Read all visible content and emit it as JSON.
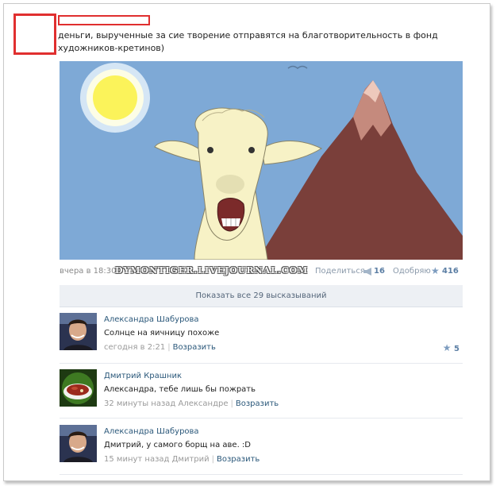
{
  "post": {
    "text": "деньги, вырученные за сие творение отправятся на благотворительность в фонд художников-кретинов)",
    "date": "вчера в 18:30",
    "watermark": "DYMONTIGER.LIVEJOURNAL.COM",
    "share_label": "Поделиться",
    "share_count": "16",
    "like_label": "Одобряю",
    "like_count": "416"
  },
  "comments_header": {
    "show_all_label": "Показать все 29 высказываний"
  },
  "comments": [
    {
      "author": "Александра Шабурова",
      "text": "Солнце на яичницу похоже",
      "time": "сегодня в 2:21",
      "reply_label": "Возразить",
      "likes": "5"
    },
    {
      "author": "Дмитрий Крашник",
      "text": "Александра, тебе лишь бы пожрать",
      "time": "32 минуты назад Александре",
      "reply_label": "Возразить"
    },
    {
      "author": "Александра Шабурова",
      "text": "Дмитрий, у самого борщ на аве. :D",
      "time": "15 минут назад Дмитрий",
      "reply_label": "Возразить"
    }
  ],
  "colors": {
    "sky": "#7ea9d6",
    "mountain": "#7a3f3a",
    "sun": "#fbf35a",
    "llama": "#f7f2c6",
    "redaction": "#e02f2f",
    "link": "#2b587a"
  },
  "icons": [
    "megaphone-icon",
    "star-icon"
  ]
}
